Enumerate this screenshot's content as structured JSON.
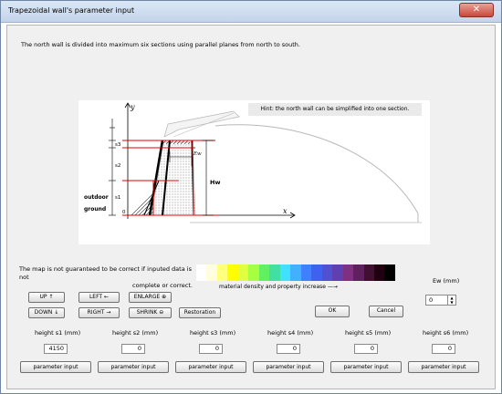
{
  "window": {
    "title": "Trapezoidal wall's parameter input",
    "close_label": "✕"
  },
  "description": "The north wall is divided into maximum six sections using parallel planes from north to south.",
  "figure": {
    "hint": "Hint: the north wall can be simplified into one section.",
    "labels": {
      "y": "y",
      "x": "x",
      "s3": "s3",
      "s2": "s2",
      "s1": "s1",
      "outdoor": "outdoor",
      "ground": "ground",
      "origin": "0",
      "ew": "Ew",
      "hw": "Hw"
    }
  },
  "warning": {
    "line1": "The map is not guaranteed to be correct if inputed data is not",
    "line2": "complete or correct."
  },
  "colorbar": {
    "colors": [
      "#ffffff",
      "#ffffe0",
      "#ffff80",
      "#ffff00",
      "#e0ff40",
      "#a8ff40",
      "#60f060",
      "#40e0a0",
      "#40e0ff",
      "#40b0ff",
      "#4080ff",
      "#4060f0",
      "#5050d0",
      "#6040b0",
      "#803080",
      "#602060",
      "#401030",
      "#200010",
      "#000000"
    ],
    "label": "material density and property increase —→"
  },
  "buttons": {
    "up": "UP ↑",
    "left": "LEFT ←",
    "enlarge": "ENLARGE ⊕",
    "down": "DOWN ↓",
    "right": "RIGHT →",
    "shrink": "SHRINK ⊖",
    "restoration": "Restoration",
    "ok": "OK",
    "cancel": "Cancel"
  },
  "ew": {
    "label": "Ew (mm)",
    "value": "0"
  },
  "heights": [
    {
      "label": "height s1 (mm)",
      "value": "4150",
      "button": "parameter input"
    },
    {
      "label": "height s2 (mm)",
      "value": "0",
      "button": "parameter input"
    },
    {
      "label": "height s3 (mm)",
      "value": "0",
      "button": "parameter input"
    },
    {
      "label": "height s4 (mm)",
      "value": "0",
      "button": "parameter input"
    },
    {
      "label": "height s5 (mm)",
      "value": "0",
      "button": "parameter input"
    },
    {
      "label": "height s6 (mm)",
      "value": "0",
      "button": "parameter input"
    }
  ]
}
